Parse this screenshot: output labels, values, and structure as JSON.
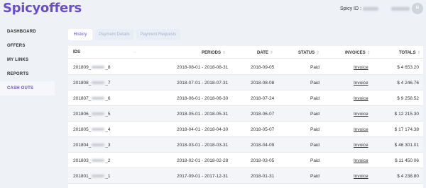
{
  "header": {
    "logo": "Spicyoffers",
    "spicy_id_label": "Spicy ID :",
    "avatar_initial": "B"
  },
  "sidebar": {
    "items": [
      {
        "label": "DASHBOARD"
      },
      {
        "label": "OFFERS"
      },
      {
        "label": "MY LINKS"
      },
      {
        "label": "REPORTS"
      },
      {
        "label": "CASH OUTS"
      }
    ],
    "active": "CASH OUTS"
  },
  "tabs": [
    {
      "label": "History",
      "active": true
    },
    {
      "label": "Payment Details",
      "active": false
    },
    {
      "label": "Payment Requests",
      "active": false
    }
  ],
  "table": {
    "columns": {
      "ids": "IDS",
      "periods": "PERIODS",
      "date": "DATE",
      "status": "STATUS",
      "invoices": "INVOICES",
      "totals": "TOTALS"
    },
    "rows": [
      {
        "id_prefix": "201809_",
        "id_suffix": "_8",
        "period": "2018-08-01 - 2018-08-31",
        "date": "2018-09-05",
        "status": "Paid",
        "invoice": "Invoice",
        "total": "$ 4 653.20"
      },
      {
        "id_prefix": "201808_",
        "id_suffix": "_7",
        "period": "2018-07-01 - 2018-07-31",
        "date": "2018-08-08",
        "status": "Paid",
        "invoice": "Invoice",
        "total": "$ 4 246.76"
      },
      {
        "id_prefix": "201807_",
        "id_suffix": "_6",
        "period": "2018-06-01 - 2018-06-30",
        "date": "2018-07-24",
        "status": "Paid",
        "invoice": "Invoice",
        "total": "$ 9 258.52"
      },
      {
        "id_prefix": "201806_",
        "id_suffix": "_5",
        "period": "2018-05-01 - 2018-05-31",
        "date": "2018-06-07",
        "status": "Paid",
        "invoice": "Invoice",
        "total": "$ 12 215.30"
      },
      {
        "id_prefix": "201805_",
        "id_suffix": "_4",
        "period": "2018-04-01 - 2018-04-30",
        "date": "2018-05-07",
        "status": "Paid",
        "invoice": "Invoice",
        "total": "$ 17 174.38"
      },
      {
        "id_prefix": "201804_",
        "id_suffix": "_3",
        "period": "2018-03-01 - 2018-03-31",
        "date": "2018-04-09",
        "status": "Paid",
        "invoice": "Invoice",
        "total": "$ 46 301.01"
      },
      {
        "id_prefix": "201803_",
        "id_suffix": "_2",
        "period": "2018-02-01 - 2018-02-28",
        "date": "2018-03-05",
        "status": "Paid",
        "invoice": "Invoice",
        "total": "$ 11 450.06"
      },
      {
        "id_prefix": "201801_",
        "id_suffix": "_1",
        "period": "2017-09-01 - 2017-12-31",
        "date": "2018-01-31",
        "status": "Paid",
        "invoice": "Invoice",
        "total": "$ 4 238.80"
      }
    ]
  }
}
